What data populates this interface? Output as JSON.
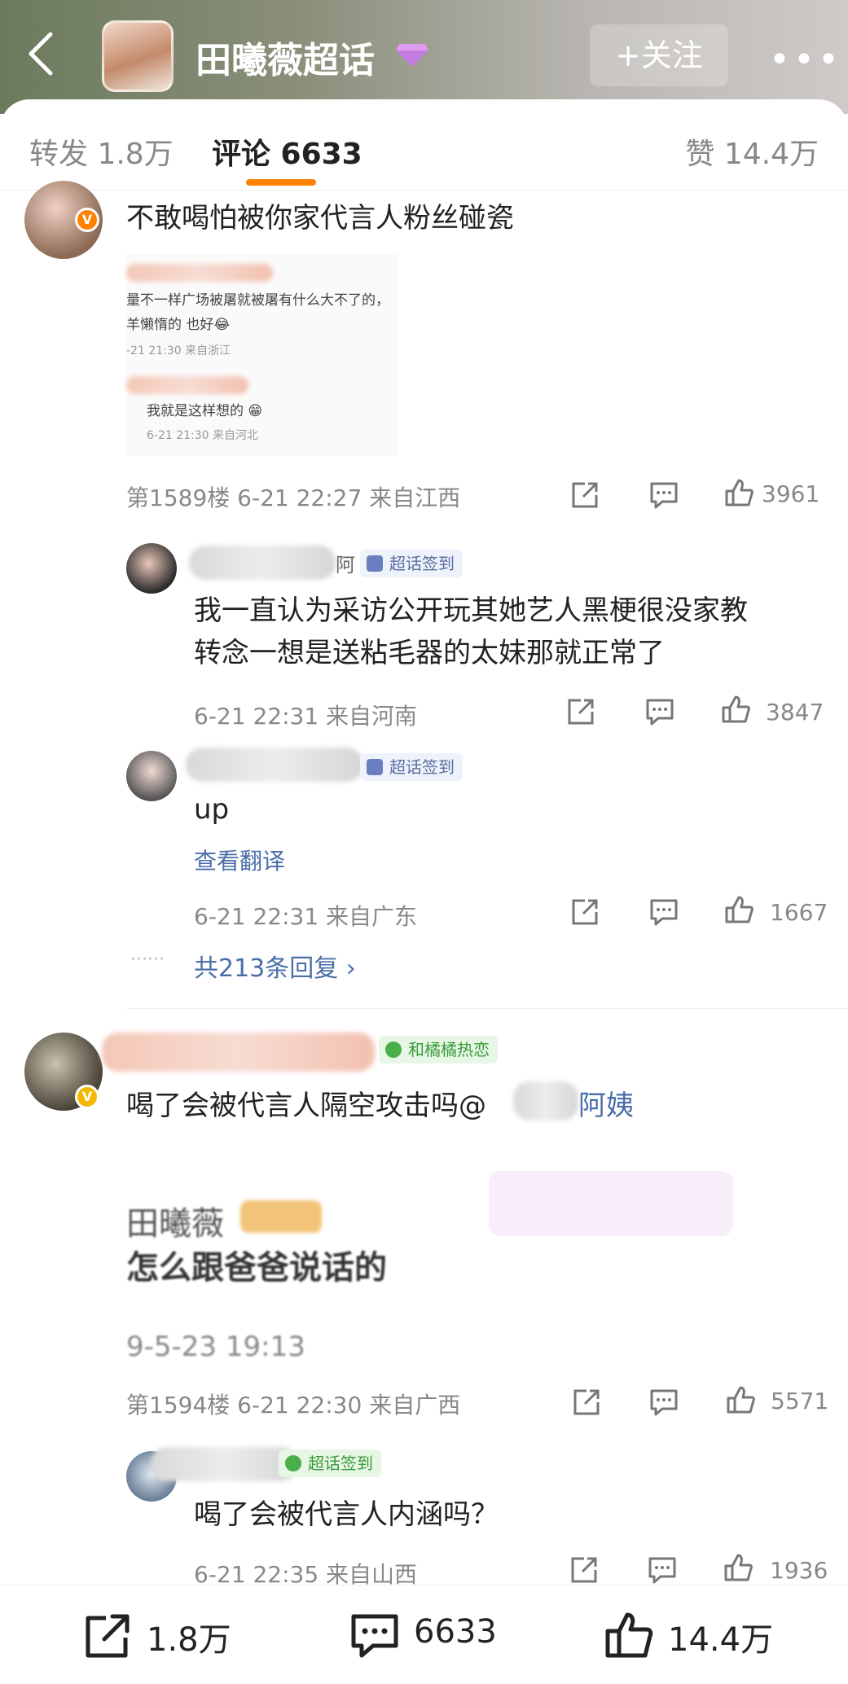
{
  "header": {
    "title": "田曦薇超话",
    "follow_label": "+关注",
    "more_label": "•••"
  },
  "tabs": {
    "repost": "转发 1.8万",
    "comments": "评论 6633",
    "likes": "赞 14.4万"
  },
  "comments": [
    {
      "text": "不敢喝怕被你家代言人粉丝碰瓷",
      "image_lines": [
        "量不一样广场被屠就被屠有什么大不了的，",
        "羊懒惰的      也好😂",
        "-21 21:30  来自浙江",
        "我就是这样想的 😁",
        "6-21 21:30  来自河北"
      ],
      "meta": "第1589楼  6-21 22:27  来自江西",
      "like_count": "3961",
      "replies": [
        {
          "name_suffix": "阿",
          "tag": "超话签到",
          "text": "我一直认为采访公开玩其她艺人黑梗很没家教",
          "text2": "转念一想是送粘毛器的太妹那就正常了",
          "meta": "6-21 22:31  来自河南",
          "like_count": "3847"
        },
        {
          "tag": "超话签到",
          "text": "up",
          "translate": "查看翻译",
          "meta": "6-21 22:31  来自广东",
          "like_count": "1667"
        }
      ],
      "more_replies": "共213条回复 ›"
    },
    {
      "tag": "和橘橘热恋",
      "text": "喝了会被代言人隔空攻击吗@",
      "mention_tail": "阿姨",
      "image_lines": [
        "田曦薇",
        "怎么跟爸爸说话的",
        "9-5-23 19:13"
      ],
      "meta": "第1594楼  6-21 22:30  来自广西",
      "like_count": "5571",
      "replies": [
        {
          "tag": "超话签到",
          "text": "喝了会被代言人内涵吗？",
          "meta": "6-21 22:35  来自山西",
          "like_count": "1936"
        }
      ]
    }
  ],
  "bottom_bar": {
    "repost": "1.8万",
    "comments": "6633",
    "likes": "14.4万"
  },
  "colors": {
    "accent": "#ff8200",
    "link": "#4a6ea8",
    "meta_text": "#888888"
  }
}
